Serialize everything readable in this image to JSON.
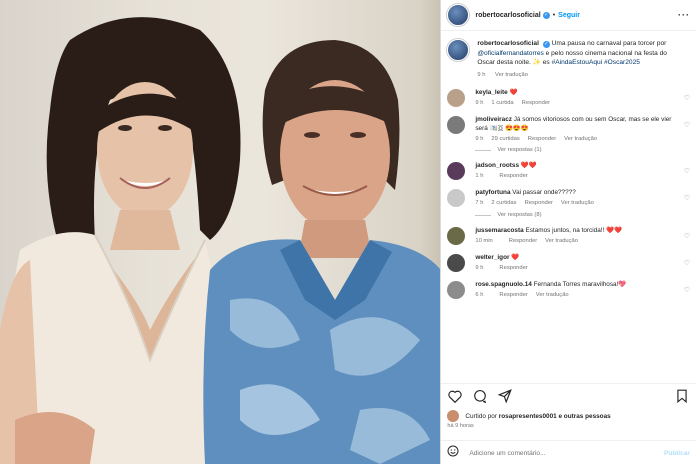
{
  "post": {
    "username": "robertocarlosoficial",
    "follow_label": "Seguir",
    "caption_user": "robertocarlosoficial",
    "caption_text": "Uma pausa no carnaval para torcer por",
    "caption_mention": "@oficialfernandatorres",
    "caption_rest": "e pelo nosso cinema nacional na festa do Oscar desta noite. ✨ es",
    "caption_tags": "#AindaEstouAqui #Oscar2025",
    "caption_time": "9 h",
    "caption_translate": "Ver tradução"
  },
  "comments": [
    {
      "user": "keyla_leite",
      "text": "❤️",
      "time": "9 h",
      "likes": "1 curtida",
      "reply": "Responder",
      "translate": "",
      "replies": "",
      "avatar_color": "#b9a08a"
    },
    {
      "user": "jmoliveiracz",
      "text": "Já somos vitoriosos com ou sem Oscar, mas se ele vier será 🇴🇴🇴 😍😍😍",
      "time": "9 h",
      "likes": "29 curtidas",
      "reply": "Responder",
      "translate": "Ver tradução",
      "replies": "Ver respostas (1)",
      "avatar_color": "#7a7a7a"
    },
    {
      "user": "jadson_rootss",
      "text": "❤️❤️",
      "time": "1 h",
      "likes": "",
      "reply": "Responder",
      "translate": "",
      "replies": "",
      "avatar_color": "#5a3a5a"
    },
    {
      "user": "patyfortuna",
      "text": "Vai passar onde?????",
      "time": "7 h",
      "likes": "2 curtidas",
      "reply": "Responder",
      "translate": "Ver tradução",
      "replies": "Ver respostas (8)",
      "avatar_color": "#c9c9c9"
    },
    {
      "user": "jussemaracosta",
      "text": "Estamos juntos, na torcida!! ❤️❤️",
      "time": "10 min",
      "likes": "",
      "reply": "Responder",
      "translate": "Ver tradução",
      "replies": "",
      "avatar_color": "#6b6a48"
    },
    {
      "user": "welter_igor",
      "text": "❤️",
      "time": "9 h",
      "likes": "",
      "reply": "Responder",
      "translate": "",
      "replies": "",
      "avatar_color": "#4a4a4a"
    },
    {
      "user": "rose.spagnuolo.14",
      "text": "Fernanda Torres maravilhosa!💖",
      "time": "6 h",
      "likes": "",
      "reply": "Responder",
      "translate": "Ver tradução",
      "replies": "",
      "avatar_color": "#8c8c8c"
    }
  ],
  "liked_by": {
    "prefix": "Curtido por",
    "user": "rosapresentes0001",
    "suffix": "e outras pessoas"
  },
  "time_ago": "há 9 horas",
  "add_comment": {
    "placeholder": "Adicione um comentário...",
    "publish": "Publicar"
  },
  "colors": {
    "accent": "#0095f6",
    "verified": "#3897f0",
    "heart": "#ed4956"
  }
}
